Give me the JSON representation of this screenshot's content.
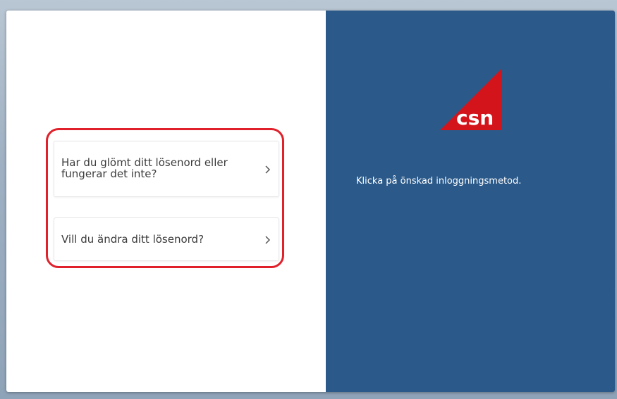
{
  "left_panel": {
    "options": [
      {
        "label": "Har du glömt ditt lösenord eller fungerar det inte?"
      },
      {
        "label": "Vill du ändra ditt lösenord?"
      }
    ]
  },
  "right_panel": {
    "logo_text": "csn",
    "instruction": "Klicka på önskad inloggningsmetod."
  },
  "colors": {
    "panel_blue": "#2b5a8a",
    "logo_red": "#d3141b",
    "highlight_red": "#e0202a"
  },
  "icons": {
    "chevron": "chevron-right-icon"
  }
}
